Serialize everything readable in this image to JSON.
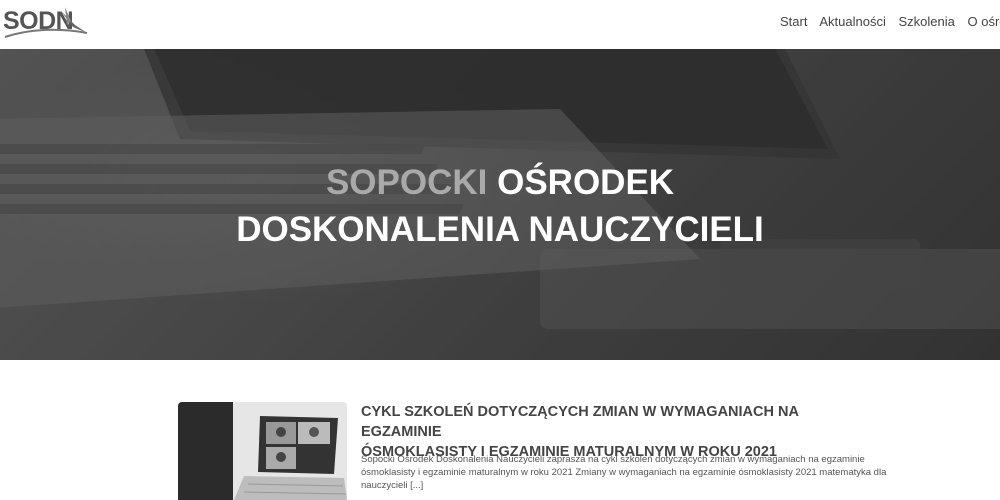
{
  "header": {
    "logo_text": "SODN",
    "nav": [
      "Start",
      "Aktualności",
      "Szkolenia",
      "O ośrodku"
    ]
  },
  "hero": {
    "line1_muted": "SOPOCKI",
    "line1_strong": "OŚRODEK",
    "line2": "DOSKONALENIA NAUCZYCIELI"
  },
  "post": {
    "title_line1": "CYKL SZKOLEŃ DOTYCZĄCYCH ZMIAN W WYMAGANIACH NA EGZAMINIE",
    "title_line2": "ÓSMOKLASISTY I EGZAMINIE MATURALNYM W ROKU 2021",
    "excerpt": "Sopocki Ośrodek Doskonalenia Nauczycieli zaprasza na cykl szkoleń dotyczących zmian w wymaganiach na egzaminie ósmoklasisty i egzaminie maturalnym w roku 2021 Zmiany w wymaganiach na egzaminie ósmoklasisty 2021 matematyka dla nauczycieli",
    "more": "[...]"
  }
}
